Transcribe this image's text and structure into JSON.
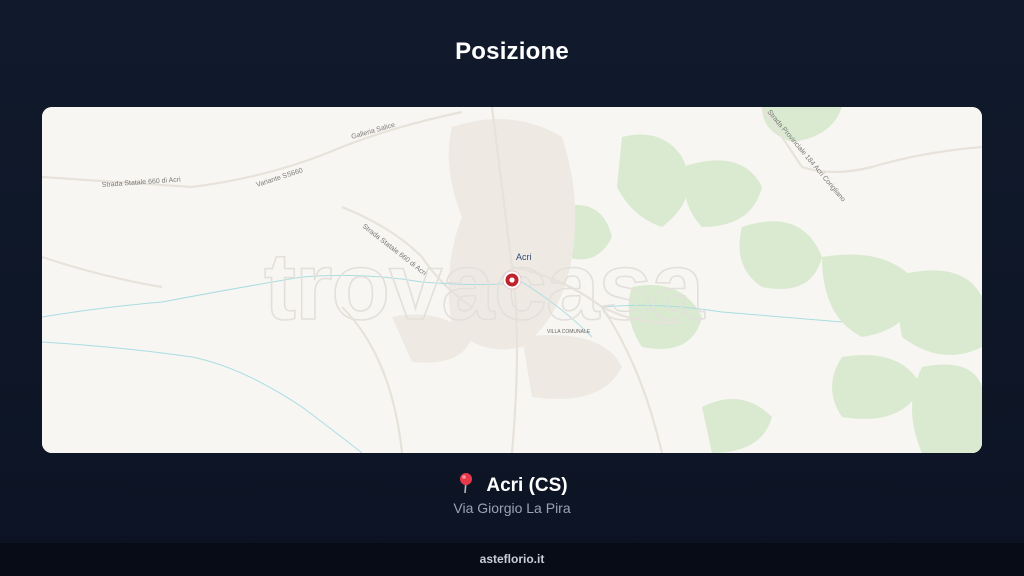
{
  "header": {
    "title": "Posizione"
  },
  "map": {
    "watermark": "trovacasa",
    "city_label": "Acri",
    "labels": {
      "galleria": "Galleria Salice",
      "variante": "Variante SS660",
      "statale_top": "Strada Statale 660 di Acri",
      "statale_mid": "Strada Statale 660 di Acri",
      "provinciale": "Strada Provinciale 184 Acri Corigliano",
      "villa": "VILLA COMUNALE"
    },
    "marker_icon": "map-marker",
    "colors": {
      "marker": "#c0232c",
      "park": "#d6e8c9",
      "water": "#8fd1d8",
      "background": "#f8f6f2"
    }
  },
  "location": {
    "pin_icon": "red-pushpin",
    "city": "Acri (CS)",
    "address": "Via Giorgio La Pira"
  },
  "footer": {
    "site": "asteflorio.it"
  }
}
